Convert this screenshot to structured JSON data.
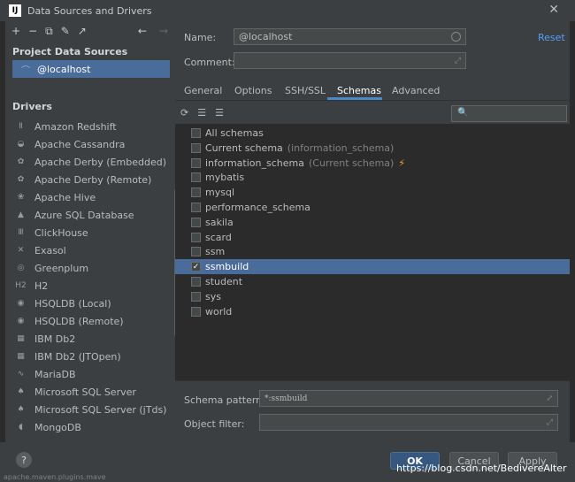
{
  "window": {
    "title": "Data Sources and Drivers",
    "close_glyph": "✕"
  },
  "left": {
    "toolbar_icons": [
      "+",
      "−",
      "⧉",
      "✎",
      "↗"
    ],
    "nav_arrows": [
      "←",
      "→"
    ],
    "project_title": "Project Data Sources",
    "project_items": [
      {
        "label": "@localhost"
      }
    ],
    "drivers_title": "Drivers",
    "drivers": [
      {
        "label": "Amazon Redshift",
        "icon": "Ⅱ"
      },
      {
        "label": "Apache Cassandra",
        "icon": "◒"
      },
      {
        "label": "Apache Derby (Embedded)",
        "icon": "✿"
      },
      {
        "label": "Apache Derby (Remote)",
        "icon": "✿"
      },
      {
        "label": "Apache Hive",
        "icon": "❀"
      },
      {
        "label": "Azure SQL Database",
        "icon": "▲"
      },
      {
        "label": "ClickHouse",
        "icon": "Ⅲ"
      },
      {
        "label": "Exasol",
        "icon": "✕"
      },
      {
        "label": "Greenplum",
        "icon": "◎"
      },
      {
        "label": "H2",
        "icon": "H2"
      },
      {
        "label": "HSQLDB (Local)",
        "icon": "◉"
      },
      {
        "label": "HSQLDB (Remote)",
        "icon": "◉"
      },
      {
        "label": "IBM Db2",
        "icon": "▦"
      },
      {
        "label": "IBM Db2 (JTOpen)",
        "icon": "▦"
      },
      {
        "label": "MariaDB",
        "icon": "∿"
      },
      {
        "label": "Microsoft SQL Server",
        "icon": "♠"
      },
      {
        "label": "Microsoft SQL Server (jTds)",
        "icon": "♠"
      },
      {
        "label": "MongoDB",
        "icon": "◖"
      }
    ]
  },
  "form": {
    "name_label": "Name:",
    "name_value": "@localhost",
    "comment_label": "Comment:",
    "comment_value": "",
    "reset_label": "Reset",
    "expand_glyph": "⤢"
  },
  "tabs": [
    {
      "label": "General"
    },
    {
      "label": "Options"
    },
    {
      "label": "SSH/SSL"
    },
    {
      "label": "Schemas"
    },
    {
      "label": "Advanced"
    }
  ],
  "schema_toolbar": [
    "⟳",
    "☰",
    "☰"
  ],
  "search": {
    "icon": "🔍",
    "value": ""
  },
  "schemas": [
    {
      "label": "All schemas",
      "note": "",
      "checked": false
    },
    {
      "label": "Current schema",
      "note": "(information_schema)",
      "checked": false
    },
    {
      "label": "information_schema",
      "note": "(Current schema)",
      "checked": false,
      "bolt": "⚡"
    },
    {
      "label": "mybatis",
      "note": "",
      "checked": false
    },
    {
      "label": "mysql",
      "note": "",
      "checked": false
    },
    {
      "label": "performance_schema",
      "note": "",
      "checked": false
    },
    {
      "label": "sakila",
      "note": "",
      "checked": false
    },
    {
      "label": "scard",
      "note": "",
      "checked": false
    },
    {
      "label": "ssm",
      "note": "",
      "checked": false
    },
    {
      "label": "ssmbuild",
      "note": "",
      "checked": true,
      "selected": true
    },
    {
      "label": "student",
      "note": "",
      "checked": false
    },
    {
      "label": "sys",
      "note": "",
      "checked": false
    },
    {
      "label": "world",
      "note": "",
      "checked": false
    }
  ],
  "schema_pattern": {
    "label": "Schema pattern:",
    "value": "*:ssmbuild"
  },
  "object_filter": {
    "label": "Object filter:",
    "value": ""
  },
  "footer": {
    "help": "?",
    "ok": "OK",
    "cancel": "Cancel",
    "apply": "Apply",
    "watermark": "https://blog.csdn.net/BedivereAlter",
    "behind_text": "apache.maven.plugins.mave"
  }
}
